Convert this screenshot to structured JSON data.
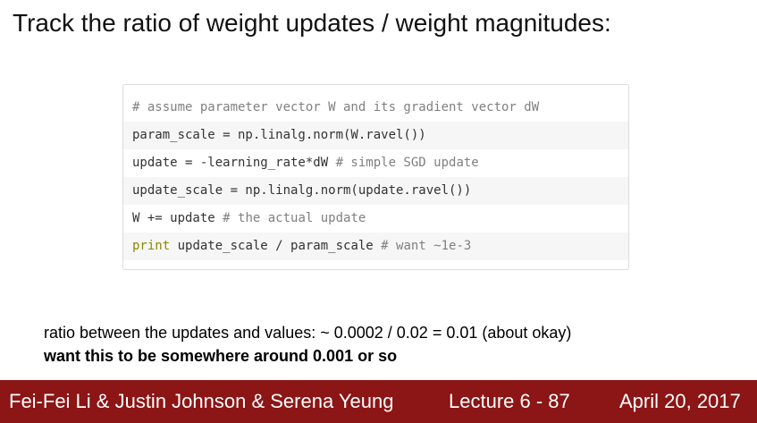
{
  "slide": {
    "title": "Track the ratio of weight updates / weight magnitudes:"
  },
  "code": {
    "line1_comment": "# assume parameter vector W and its gradient vector dW",
    "line2_code": "param_scale = np.linalg.norm(W.ravel())",
    "line3_code": "update = -learning_rate*dW ",
    "line3_comment": "# simple SGD update",
    "line4_code": "update_scale = np.linalg.norm(update.ravel())",
    "line5_code": "W += update ",
    "line5_comment": "# the actual update",
    "line6_keyword": "print",
    "line6_code": " update_scale / param_scale ",
    "line6_comment": "# want ~1e-3"
  },
  "notes": {
    "line1": "ratio between the updates and values: ~ 0.0002 / 0.02 = 0.01 (about okay)",
    "line2": "want this to be somewhere around 0.001 or so"
  },
  "footer": {
    "authors": "Fei-Fei Li & Justin Johnson & Serena Yeung",
    "lecture": "Lecture 6 - 87",
    "date": "April 20, 2017"
  },
  "colors": {
    "footer_background": "#8c1515",
    "code_comment": "#808080",
    "code_keyword": "#8a8a00"
  }
}
